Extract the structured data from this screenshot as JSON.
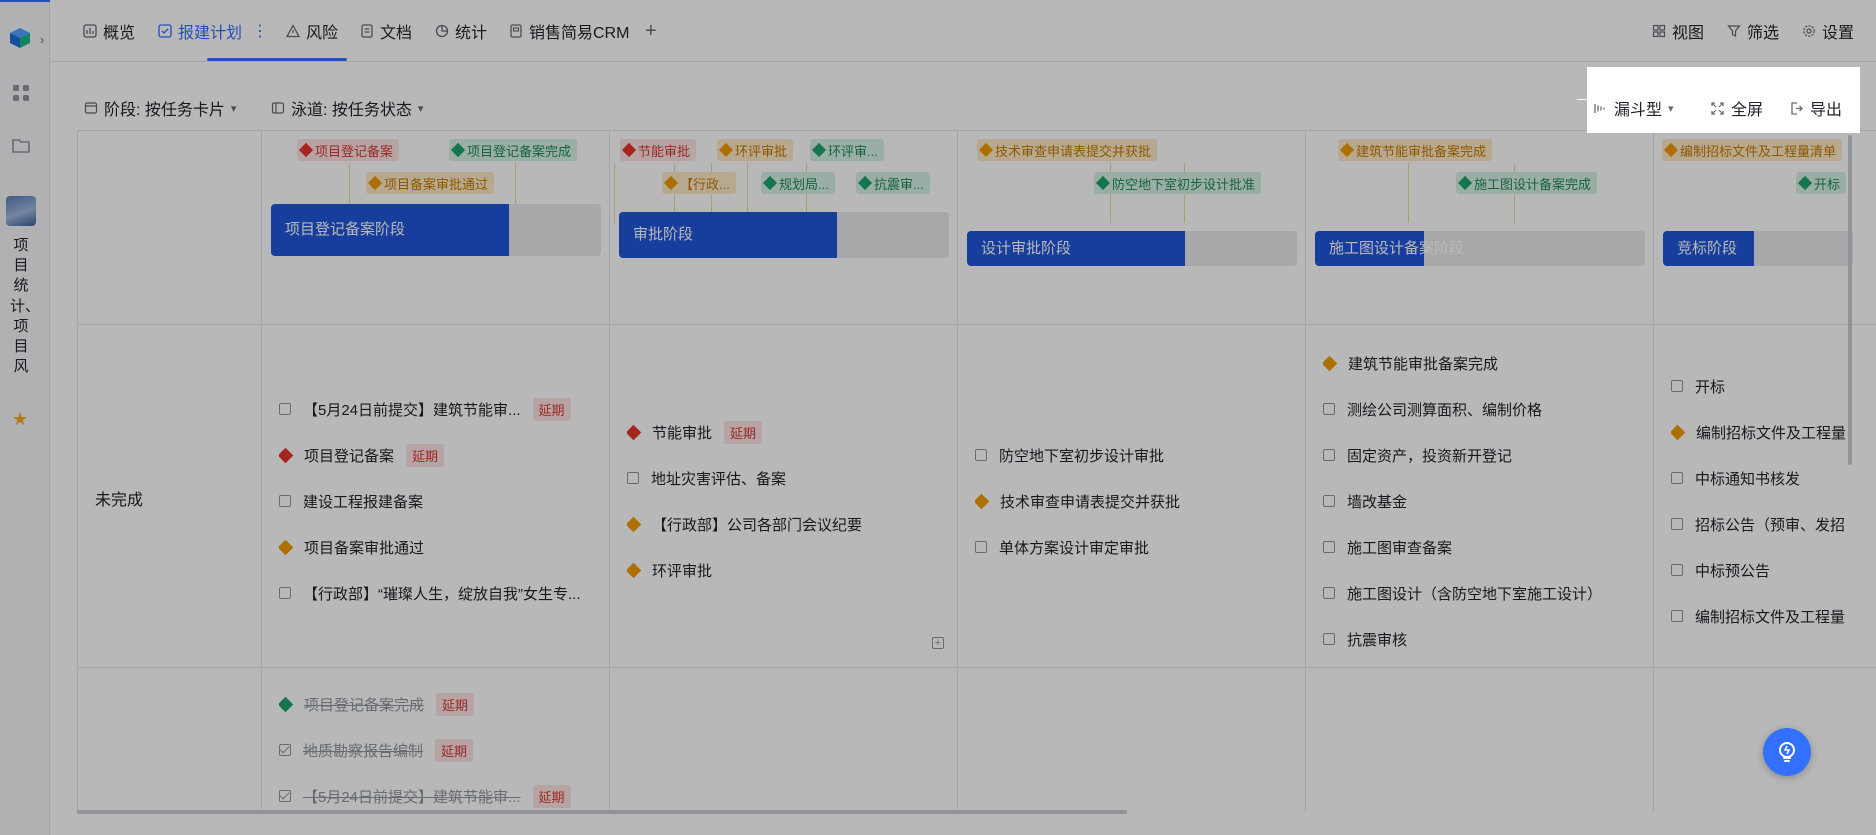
{
  "tabs": [
    {
      "label": "概览",
      "icon": "dashboard-icon"
    },
    {
      "label": "报建计划",
      "icon": "check-square-icon",
      "active": true
    },
    {
      "label": "风险",
      "icon": "warning-icon"
    },
    {
      "label": "文档",
      "icon": "doc-icon"
    },
    {
      "label": "统计",
      "icon": "pie-chart-icon"
    },
    {
      "label": "销售简易CRM",
      "icon": "form-icon"
    }
  ],
  "tab_more": "⋮",
  "tab_add": "+",
  "header_actions": {
    "view": "视图",
    "filter": "筛选",
    "settings": "设置"
  },
  "sidebar": {
    "project_name": "项目统计、项目风"
  },
  "toolbar": {
    "stage": "阶段: 按任务卡片",
    "lane": "泳道: 按任务状态",
    "funnel": "漏斗型",
    "fullscreen": "全屏",
    "export": "导出"
  },
  "milestones": {
    "col1": [
      {
        "label": "项目登记备案",
        "color": "red"
      },
      {
        "label": "项目登记备案完成",
        "color": "green"
      },
      {
        "label": "项目备案审批通过",
        "color": "orange"
      }
    ],
    "col2": [
      {
        "label": "节能审批",
        "color": "red"
      },
      {
        "label": "环评审批",
        "color": "orange"
      },
      {
        "label": "环评审...",
        "color": "green"
      },
      {
        "label": "【行政...",
        "color": "orange"
      },
      {
        "label": "规划局...",
        "color": "green"
      },
      {
        "label": "抗震审...",
        "color": "green"
      }
    ],
    "col3": [
      {
        "label": "技术审查申请表提交并获批",
        "color": "orange"
      },
      {
        "label": "防空地下室初步设计批准",
        "color": "green"
      }
    ],
    "col4": [
      {
        "label": "建筑节能审批备案完成",
        "color": "orange"
      },
      {
        "label": "施工图设计备案完成",
        "color": "green"
      }
    ],
    "col5": [
      {
        "label": "编制招标文件及工程量清单",
        "color": "orange"
      },
      {
        "label": "开标",
        "color": "green"
      }
    ]
  },
  "phases": [
    {
      "label": "项目登记备案阶段",
      "progress": 0.72
    },
    {
      "label": "审批阶段",
      "progress": 0.66
    },
    {
      "label": "设计审批阶段",
      "progress": 0.66
    },
    {
      "label": "施工图设计备案阶段",
      "progress": 0.33
    },
    {
      "label": "竞标阶段",
      "progress": 0.48
    }
  ],
  "lanes": {
    "incomplete": "未完成"
  },
  "late_label": "延期",
  "tasks": {
    "col1": [
      {
        "text": "【5月24日前提交】建筑节能审...",
        "type": "checkbox",
        "late": true
      },
      {
        "text": "项目登记备案",
        "type": "red",
        "late": true
      },
      {
        "text": "建设工程报建备案",
        "type": "checkbox"
      },
      {
        "text": "项目备案审批通过",
        "type": "orange"
      },
      {
        "text": "【行政部】“璀璨人生，绽放自我”女生专...",
        "type": "checkbox"
      }
    ],
    "col2": [
      {
        "text": "节能审批",
        "type": "red",
        "late": true
      },
      {
        "text": "地址灾害评估、备案",
        "type": "checkbox"
      },
      {
        "text": "【行政部】公司各部门会议纪要",
        "type": "orange"
      },
      {
        "text": "环评审批",
        "type": "orange"
      }
    ],
    "col3": [
      {
        "text": "防空地下室初步设计审批",
        "type": "checkbox"
      },
      {
        "text": "技术审查申请表提交并获批",
        "type": "orange"
      },
      {
        "text": "单体方案设计审定审批",
        "type": "checkbox"
      }
    ],
    "col4": [
      {
        "text": "建筑节能审批备案完成",
        "type": "orange"
      },
      {
        "text": "测绘公司测算面积、编制价格",
        "type": "checkbox"
      },
      {
        "text": "固定资产，投资新开登记",
        "type": "checkbox"
      },
      {
        "text": "墙改基金",
        "type": "checkbox"
      },
      {
        "text": "施工图审查备案",
        "type": "checkbox"
      },
      {
        "text": "施工图设计（含防空地下室施工设计）",
        "type": "checkbox"
      },
      {
        "text": "抗震审核",
        "type": "checkbox"
      }
    ],
    "col5": [
      {
        "text": "开标",
        "type": "checkbox"
      },
      {
        "text": "编制招标文件及工程量",
        "type": "orange"
      },
      {
        "text": "中标通知书核发",
        "type": "checkbox"
      },
      {
        "text": "招标公告（预审、发招",
        "type": "checkbox"
      },
      {
        "text": "中标预公告",
        "type": "checkbox"
      },
      {
        "text": "编制招标文件及工程量",
        "type": "checkbox"
      }
    ],
    "done_col1": [
      {
        "text": "项目登记备案完成",
        "type": "green",
        "late": true
      },
      {
        "text": "地质勘察报告编制",
        "type": "checked",
        "late": true
      },
      {
        "text": "【5月24日前提交】建筑节能审...",
        "type": "checked",
        "late": true
      }
    ]
  },
  "colors": {
    "accent": "#3370ff",
    "phase_fill": "#2156d9",
    "late_red": "#d83931"
  }
}
